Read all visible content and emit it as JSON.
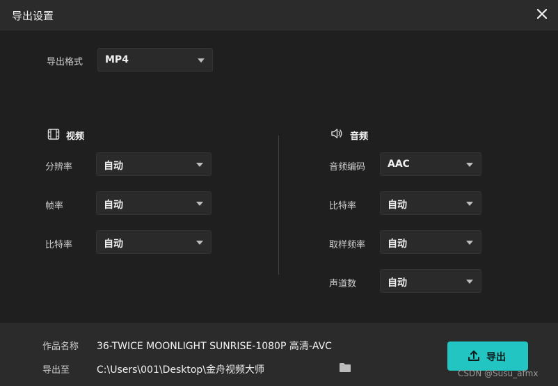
{
  "dialog": {
    "title": "导出设置"
  },
  "format": {
    "label": "导出格式",
    "value": "MP4"
  },
  "video": {
    "title": "视频",
    "resolution": {
      "label": "分辨率",
      "value": "自动"
    },
    "framerate": {
      "label": "帧率",
      "value": "自动"
    },
    "bitrate": {
      "label": "比特率",
      "value": "自动"
    }
  },
  "audio": {
    "title": "音频",
    "codec": {
      "label": "音频编码",
      "value": "AAC"
    },
    "bitrate": {
      "label": "比特率",
      "value": "自动"
    },
    "samplerate": {
      "label": "取样频率",
      "value": "自动"
    },
    "channels": {
      "label": "声道数",
      "value": "自动"
    }
  },
  "footer": {
    "name_label": "作品名称",
    "name_value": "36-TWICE MOONLIGHT SUNRISE-1080P 高清-AVC",
    "path_label": "导出至",
    "path_value": "C:\\Users\\001\\Desktop\\金舟视频大师",
    "export_label": "导出"
  },
  "watermark": "CSDN @Susu_afmx",
  "colors": {
    "accent": "#22c5c2",
    "background": "#1f1f1f",
    "panel": "#2b2b2b"
  }
}
